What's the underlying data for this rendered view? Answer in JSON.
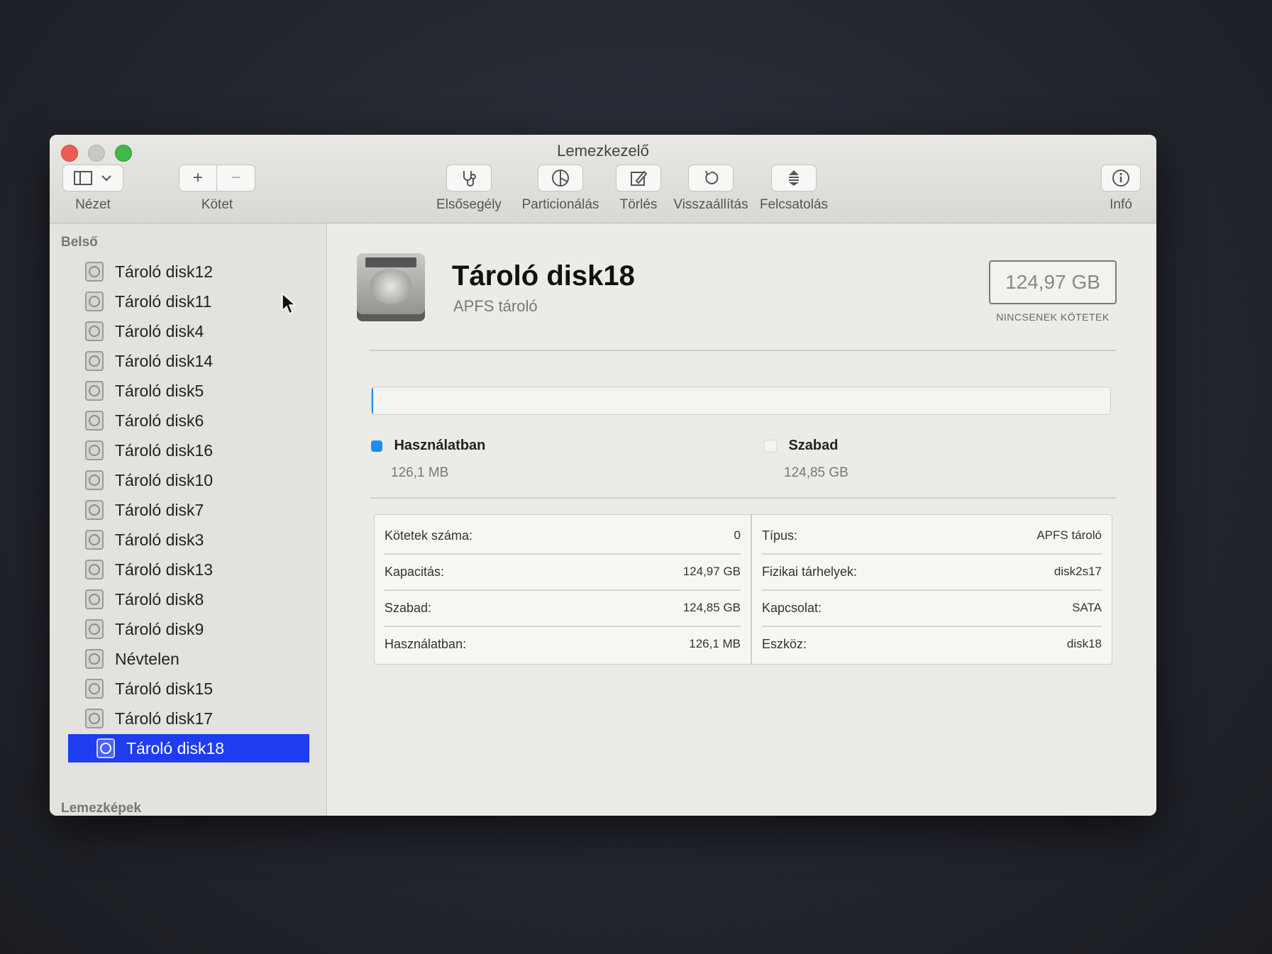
{
  "window": {
    "title": "Lemezkezelő"
  },
  "toolbar": {
    "view_label": "Nézet",
    "volume_label": "Kötet",
    "volume_add": "+",
    "volume_remove": "−",
    "first_aid": "Elsősegély",
    "partition": "Particionálás",
    "erase": "Törlés",
    "restore": "Visszaállítás",
    "mount": "Felcsatolás",
    "info": "Infó"
  },
  "sidebar": {
    "section_internal": "Belső",
    "section_images": "Lemezképek",
    "items": [
      {
        "label": "Tároló disk12"
      },
      {
        "label": "Tároló disk11"
      },
      {
        "label": "Tároló disk4"
      },
      {
        "label": "Tároló disk14"
      },
      {
        "label": "Tároló disk5"
      },
      {
        "label": "Tároló disk6"
      },
      {
        "label": "Tároló disk16"
      },
      {
        "label": "Tároló disk10"
      },
      {
        "label": "Tároló disk7"
      },
      {
        "label": "Tároló disk3"
      },
      {
        "label": "Tároló disk13"
      },
      {
        "label": "Tároló disk8"
      },
      {
        "label": "Tároló disk9"
      },
      {
        "label": "Névtelen"
      },
      {
        "label": "Tároló disk15"
      },
      {
        "label": "Tároló disk17"
      },
      {
        "label": "Tároló disk18"
      }
    ],
    "selected_index": 16
  },
  "detail": {
    "title": "Tároló disk18",
    "subtitle": "APFS tároló",
    "capacity": "124,97 GB",
    "capacity_caption": "NINCSENEK KÖTETEK",
    "usage_fraction": 0.001,
    "used_color": "#1e8cf1",
    "free_color": "#f4f4f1",
    "legend": {
      "used_label": "Használatban",
      "used_value": "126,1 MB",
      "free_label": "Szabad",
      "free_value": "124,85 GB"
    },
    "info_left": [
      {
        "k": "Kötetek száma:",
        "v": "0"
      },
      {
        "k": "Kapacitás:",
        "v": "124,97 GB"
      },
      {
        "k": "Szabad:",
        "v": "124,85 GB"
      },
      {
        "k": "Használatban:",
        "v": "126,1 MB"
      }
    ],
    "info_right": [
      {
        "k": "Típus:",
        "v": "APFS tároló"
      },
      {
        "k": "Fizikai tárhelyek:",
        "v": "disk2s17"
      },
      {
        "k": "Kapcsolat:",
        "v": "SATA"
      },
      {
        "k": "Eszköz:",
        "v": "disk18"
      }
    ]
  },
  "icons": [
    "sidebar-toggle-icon",
    "chevron-down-icon",
    "stethoscope-icon",
    "pie-chart-icon",
    "eraser-icon",
    "restore-arrow-icon",
    "mount-icon",
    "info-icon",
    "hard-disk-icon",
    "mouse-pointer-icon"
  ]
}
